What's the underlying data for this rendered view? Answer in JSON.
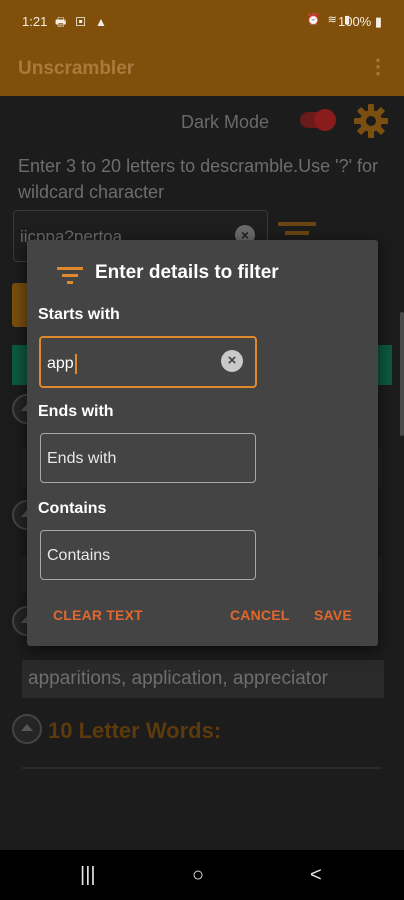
{
  "status_bar": {
    "time": "1:21",
    "left_icons": [
      "printer-icon",
      "square-icon",
      "warning-icon"
    ],
    "right_icons": [
      "alarm-icon",
      "wifi-icon",
      "signal-icon"
    ],
    "battery": "100%"
  },
  "app_bar": {
    "title": "Unscrambler",
    "menu_icon": "⋮"
  },
  "settings": {
    "dark_mode_label": "Dark Mode",
    "dark_mode_on": true
  },
  "instructions": "Enter 3 to 20 letters to descramble.Use '?' for wildcard character",
  "word_input": {
    "value": "iicppa?pertoa"
  },
  "results": {
    "word_list_text": "apparitions, application, appreciator",
    "heading_10": "10 Letter Words:"
  },
  "dialog": {
    "title": "Enter details to filter",
    "starts_with_label": "Starts with",
    "starts_with_value": "app",
    "ends_with_label": "Ends with",
    "ends_with_placeholder": "Ends with",
    "contains_label": "Contains",
    "contains_placeholder": "Contains",
    "clear_text_button": "CLEAR TEXT",
    "cancel_button": "CANCEL",
    "save_button": "SAVE"
  },
  "navbar": {
    "recents": "|||",
    "home": "○",
    "back": "<"
  },
  "colors": {
    "accent": "#e0882c",
    "app_bar": "#7f500b",
    "dialog_bg": "#444444",
    "dialog_button": "#e0682c"
  }
}
